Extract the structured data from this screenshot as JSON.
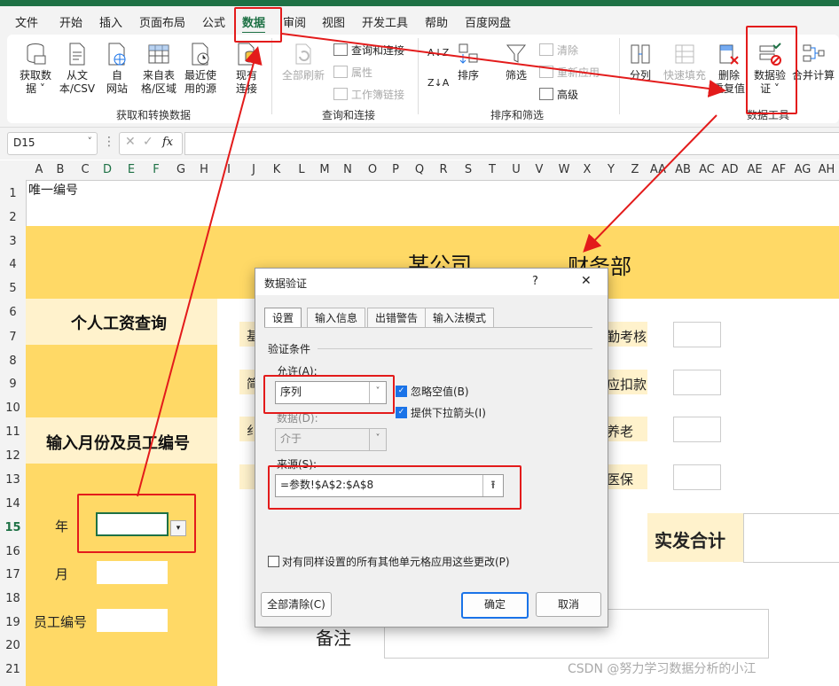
{
  "menu": [
    "文件",
    "开始",
    "插入",
    "页面布局",
    "公式",
    "数据",
    "审阅",
    "视图",
    "开发工具",
    "帮助",
    "百度网盘"
  ],
  "ribbon": {
    "get_data": {
      "l1": "获取数",
      "l2": "据 ˅"
    },
    "from_text": {
      "l1": "从文",
      "l2": "本/CSV"
    },
    "from_web": {
      "l1": "自",
      "l2": "网站"
    },
    "from_table": {
      "l1": "来自表",
      "l2": "格/区域"
    },
    "recent": {
      "l1": "最近使",
      "l2": "用的源"
    },
    "existing": {
      "l1": "现有",
      "l2": "连接"
    },
    "group_get": "获取和转换数据",
    "refresh_all": "全部刷新",
    "queries": "查询和连接",
    "properties": "属性",
    "workbook_links": "工作簿链接",
    "group_query": "查询和连接",
    "sort_az": "A↓Z",
    "sort_za": "Z↓A",
    "sort": "排序",
    "filter": "筛选",
    "clear": "清除",
    "reapply": "重新应用",
    "advanced": "高级",
    "group_sort": "排序和筛选",
    "split": "分列",
    "flash_fill": "快速填充",
    "remove_dup": {
      "l1": "删除",
      "l2": "重复值"
    },
    "validation": {
      "l1": "数据验",
      "l2": "证 ˅"
    },
    "consolidate": "合并计算",
    "group_tools": "数据工具"
  },
  "namebox": "D15",
  "fx": "fx",
  "columns": [
    "A",
    "B",
    "C",
    "D",
    "E",
    "F",
    "G",
    "H",
    "I",
    "J",
    "K",
    "L",
    "M",
    "N",
    "O",
    "P",
    "Q",
    "R",
    "S",
    "T",
    "U",
    "V",
    "W",
    "X",
    "Y",
    "Z",
    "AA",
    "AB",
    "AC",
    "AD",
    "AE",
    "AF",
    "AG",
    "AH"
  ],
  "rows": [
    "1",
    "2",
    "3",
    "4",
    "5",
    "6",
    "7",
    "8",
    "9",
    "10",
    "11",
    "12",
    "13",
    "14",
    "15",
    "16",
    "17",
    "18",
    "19",
    "20",
    "21"
  ],
  "sheet": {
    "a1": "唯一编号",
    "company": "某公司",
    "dept": "财务部",
    "query_title": "个人工资查询",
    "input_title": "输入月份及员工编号",
    "year": "年",
    "month": "月",
    "emp_id": "员工编号",
    "right1": "勤考核",
    "right2": "应扣款",
    "right3": "养老",
    "right4": "医保",
    "left1": "基",
    "left2": "简",
    "left3": "纟",
    "net_total": "实发合计",
    "remark": "备注"
  },
  "dialog": {
    "title": "数据验证",
    "help": "?",
    "close": "✕",
    "tabs": [
      "设置",
      "输入信息",
      "出错警告",
      "输入法模式"
    ],
    "section": "验证条件",
    "allow_label": "允许(A):",
    "allow_value": "序列",
    "ignore_blank": "忽略空值(B)",
    "dropdown": "提供下拉箭头(I)",
    "data_label": "数据(D):",
    "data_value": "介于",
    "source_label": "来源(S):",
    "source_value": "=参数!$A$2:$A$8",
    "apply_all": "对有同样设置的所有其他单元格应用这些更改(P)",
    "clear_all": "全部清除(C)",
    "ok": "确定",
    "cancel": "取消"
  },
  "watermark": "CSDN @努力学习数据分析的小江",
  "colors": {
    "excel_green": "#1e7145",
    "yellow": "#ffd966",
    "light_yellow": "#fff2cc",
    "highlight_red": "#e31b1b"
  }
}
